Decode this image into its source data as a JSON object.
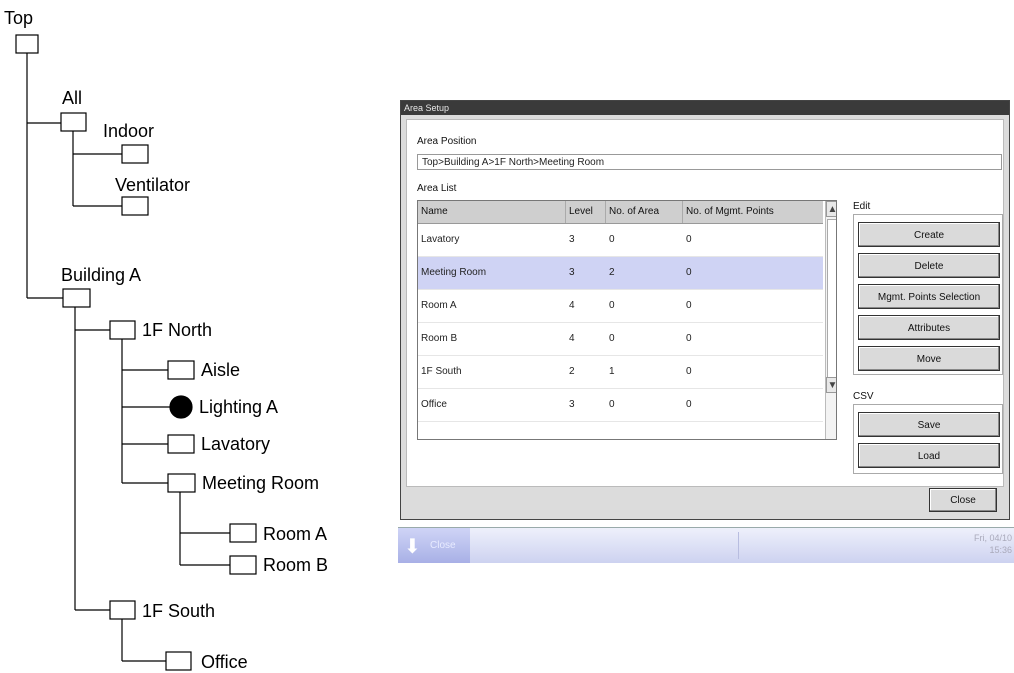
{
  "tree": {
    "labels": {
      "top": "Top",
      "all": "All",
      "indoor": "Indoor",
      "ventilator": "Ventilator",
      "building_a": "Building A",
      "north_1f": "1F North",
      "aisle": "Aisle",
      "lighting_a": "Lighting A",
      "lavatory": "Lavatory",
      "meeting_room": "Meeting Room",
      "room_a": "Room A",
      "room_b": "Room B",
      "south_1f": "1F South",
      "office": "Office"
    }
  },
  "window": {
    "title": "Area Setup",
    "area_position_label": "Area Position",
    "area_position_value": "Top>Building A>1F North>Meeting Room",
    "area_list_label": "Area List",
    "columns": [
      "Name",
      "Level",
      "No. of Area",
      "No. of Mgmt. Points"
    ],
    "rows": [
      {
        "name": "Lavatory",
        "level": "3",
        "areas": "0",
        "points": "0",
        "selected": false
      },
      {
        "name": "Meeting Room",
        "level": "3",
        "areas": "2",
        "points": "0",
        "selected": true
      },
      {
        "name": "Room A",
        "level": "4",
        "areas": "0",
        "points": "0",
        "selected": false
      },
      {
        "name": "Room B",
        "level": "4",
        "areas": "0",
        "points": "0",
        "selected": false
      },
      {
        "name": "1F South",
        "level": "2",
        "areas": "1",
        "points": "0",
        "selected": false
      },
      {
        "name": "Office",
        "level": "3",
        "areas": "0",
        "points": "0",
        "selected": false
      }
    ],
    "edit_label": "Edit",
    "edit_buttons": [
      "Create",
      "Delete",
      "Mgmt. Points Selection",
      "Attributes",
      "Move"
    ],
    "csv_label": "CSV",
    "csv_buttons": [
      "Save",
      "Load"
    ],
    "close_label": "Close",
    "selected_row_color": "#cfd3f4"
  },
  "taskbar": {
    "left_label": "Close",
    "date": "Fri, 04/10",
    "time": "15:36"
  }
}
